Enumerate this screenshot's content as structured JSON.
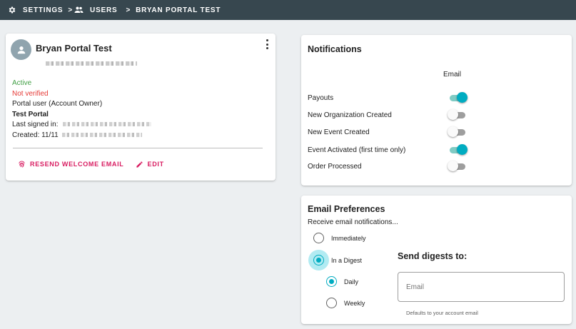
{
  "breadcrumb": {
    "settings": "SETTINGS",
    "separator": ">",
    "users": "USERS",
    "current": "BRYAN PORTAL TEST"
  },
  "icons": {
    "settings": "gear-icon",
    "users": "people-icon",
    "avatar": "person-icon",
    "menu": "more-vert-icon",
    "resend": "fingerprint-icon",
    "edit": "pencil-icon"
  },
  "user": {
    "name": "Bryan Portal Test",
    "status_active": "Active",
    "status_verified": "Not verified",
    "role": "Portal user (Account Owner)",
    "organization": "Test Portal",
    "last_signed_in_label": "Last signed in:",
    "created_label": "Created: 11/11",
    "actions": {
      "resend": "RESEND WELCOME EMAIL",
      "edit": "EDIT"
    }
  },
  "notifications": {
    "title": "Notifications",
    "column": "Email",
    "items": [
      {
        "label": "Payouts",
        "enabled": true
      },
      {
        "label": "New Organization Created",
        "enabled": false
      },
      {
        "label": "New Event Created",
        "enabled": false
      },
      {
        "label": "Event Activated (first time only)",
        "enabled": true
      },
      {
        "label": "Order Processed",
        "enabled": false
      }
    ]
  },
  "email_preferences": {
    "title": "Email Preferences",
    "subtitle": "Receive email notifications...",
    "options": {
      "immediately": "Immediately",
      "digest": "In a Digest",
      "daily": "Daily",
      "weekly": "Weekly"
    },
    "selected": "digest",
    "frequency": "daily",
    "digest_title": "Send digests to:",
    "email_placeholder": "Email",
    "email_value": "",
    "helper": "Defaults to your account email"
  },
  "colors": {
    "topbar": "#37474f",
    "accent": "#00acc1",
    "action": "#d81b60",
    "active": "#43a047",
    "warning": "#e53935"
  }
}
